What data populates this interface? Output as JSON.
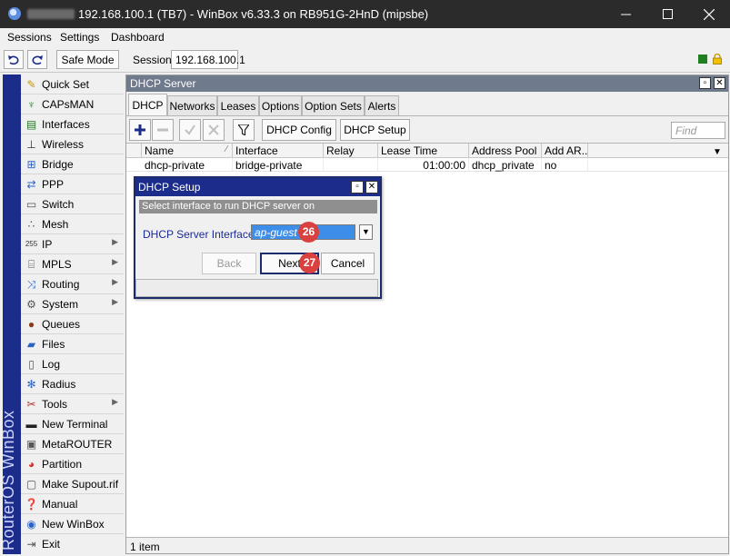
{
  "window": {
    "title": "192.168.100.1 (TB7) - WinBox v6.33.3 on RB951G-2HnD (mipsbe)"
  },
  "menubar": {
    "items": [
      "Sessions",
      "Settings",
      "Dashboard"
    ]
  },
  "toolbar": {
    "safe_mode_label": "Safe Mode",
    "session_label": "Session:",
    "session_value": "192.168.100.1"
  },
  "brand": {
    "text": "RouterOS WinBox"
  },
  "sidebar": {
    "items": [
      {
        "label": "Quick Set",
        "icon": "quick-set-icon",
        "submenu": false
      },
      {
        "label": "CAPsMAN",
        "icon": "capsman-icon",
        "submenu": false
      },
      {
        "label": "Interfaces",
        "icon": "interfaces-icon",
        "submenu": false
      },
      {
        "label": "Wireless",
        "icon": "wireless-icon",
        "submenu": false
      },
      {
        "label": "Bridge",
        "icon": "bridge-icon",
        "submenu": false
      },
      {
        "label": "PPP",
        "icon": "ppp-icon",
        "submenu": false
      },
      {
        "label": "Switch",
        "icon": "switch-icon",
        "submenu": false
      },
      {
        "label": "Mesh",
        "icon": "mesh-icon",
        "submenu": false
      },
      {
        "label": "IP",
        "icon": "ip-icon",
        "submenu": true
      },
      {
        "label": "MPLS",
        "icon": "mpls-icon",
        "submenu": true
      },
      {
        "label": "Routing",
        "icon": "routing-icon",
        "submenu": true
      },
      {
        "label": "System",
        "icon": "system-icon",
        "submenu": true
      },
      {
        "label": "Queues",
        "icon": "queues-icon",
        "submenu": false
      },
      {
        "label": "Files",
        "icon": "files-icon",
        "submenu": false
      },
      {
        "label": "Log",
        "icon": "log-icon",
        "submenu": false
      },
      {
        "label": "Radius",
        "icon": "radius-icon",
        "submenu": false
      },
      {
        "label": "Tools",
        "icon": "tools-icon",
        "submenu": true
      },
      {
        "label": "New Terminal",
        "icon": "terminal-icon",
        "submenu": false
      },
      {
        "label": "MetaROUTER",
        "icon": "metarouter-icon",
        "submenu": false
      },
      {
        "label": "Partition",
        "icon": "partition-icon",
        "submenu": false
      },
      {
        "label": "Make Supout.rif",
        "icon": "supout-icon",
        "submenu": false
      },
      {
        "label": "Manual",
        "icon": "manual-icon",
        "submenu": false
      },
      {
        "label": "New WinBox",
        "icon": "winbox-icon",
        "submenu": false
      },
      {
        "label": "Exit",
        "icon": "exit-icon",
        "submenu": false
      }
    ]
  },
  "dhcp_window": {
    "title": "DHCP Server",
    "tabs": [
      "DHCP",
      "Networks",
      "Leases",
      "Options",
      "Option Sets",
      "Alerts"
    ],
    "buttons": {
      "config": "DHCP Config",
      "setup": "DHCP Setup"
    },
    "find_placeholder": "Find",
    "columns": [
      "Name",
      "Interface",
      "Relay",
      "Lease Time",
      "Address Pool",
      "Add AR..."
    ],
    "rows": [
      {
        "name": "dhcp-private",
        "interface": "bridge-private",
        "relay": "",
        "lease_time": "01:00:00",
        "address_pool": "dhcp_private",
        "add_arp": "no"
      }
    ],
    "status": "1 item"
  },
  "dialog": {
    "title": "DHCP Setup",
    "info": "Select interface to run DHCP server on",
    "interface_label": "DHCP Server Interface:",
    "interface_value": "ap-guest",
    "back_label": "Back",
    "next_label": "Next",
    "cancel_label": "Cancel"
  },
  "annotations": {
    "step_a": "26",
    "step_b": "27"
  },
  "colors": {
    "title_bar": "#2b2b2b",
    "brand_bar": "#1b2c8a",
    "dialog_title": "#1b2c8a",
    "selection": "#3d8ee9",
    "badge": "#d9413f"
  }
}
